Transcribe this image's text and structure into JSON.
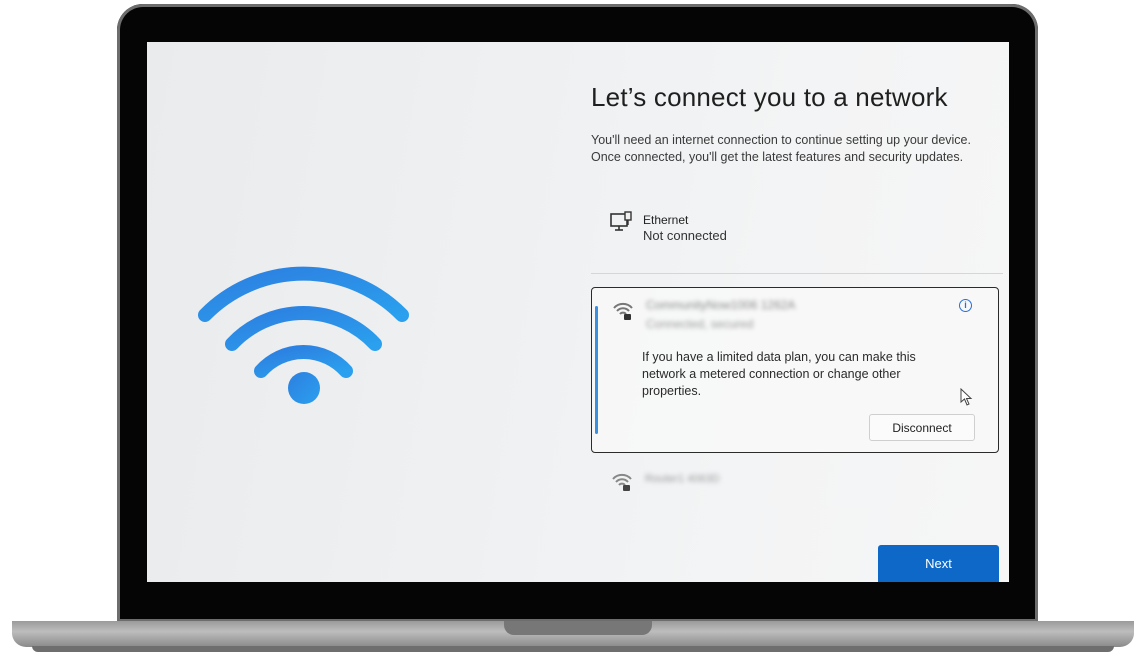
{
  "page": {
    "title": "Let’s connect you to a network",
    "description": "You'll need an internet connection to continue setting up your device. Once connected, you'll get the latest features and security updates."
  },
  "ethernet": {
    "name": "Ethernet",
    "status": "Not connected",
    "icon": "ethernet-monitor-icon"
  },
  "selected_network": {
    "name": "CommunityNow1006 1262A",
    "status": "Connected, secured",
    "info_icon": "info-icon",
    "message": "If you have a limited data plan, you can make this network a metered connection or change other properties.",
    "disconnect_label": "Disconnect"
  },
  "other_network": {
    "name": "Router1 4063D"
  },
  "actions": {
    "next_label": "Next"
  },
  "colors": {
    "accent": "#0d68c8",
    "wifi_icon": "#2b8fe6"
  }
}
